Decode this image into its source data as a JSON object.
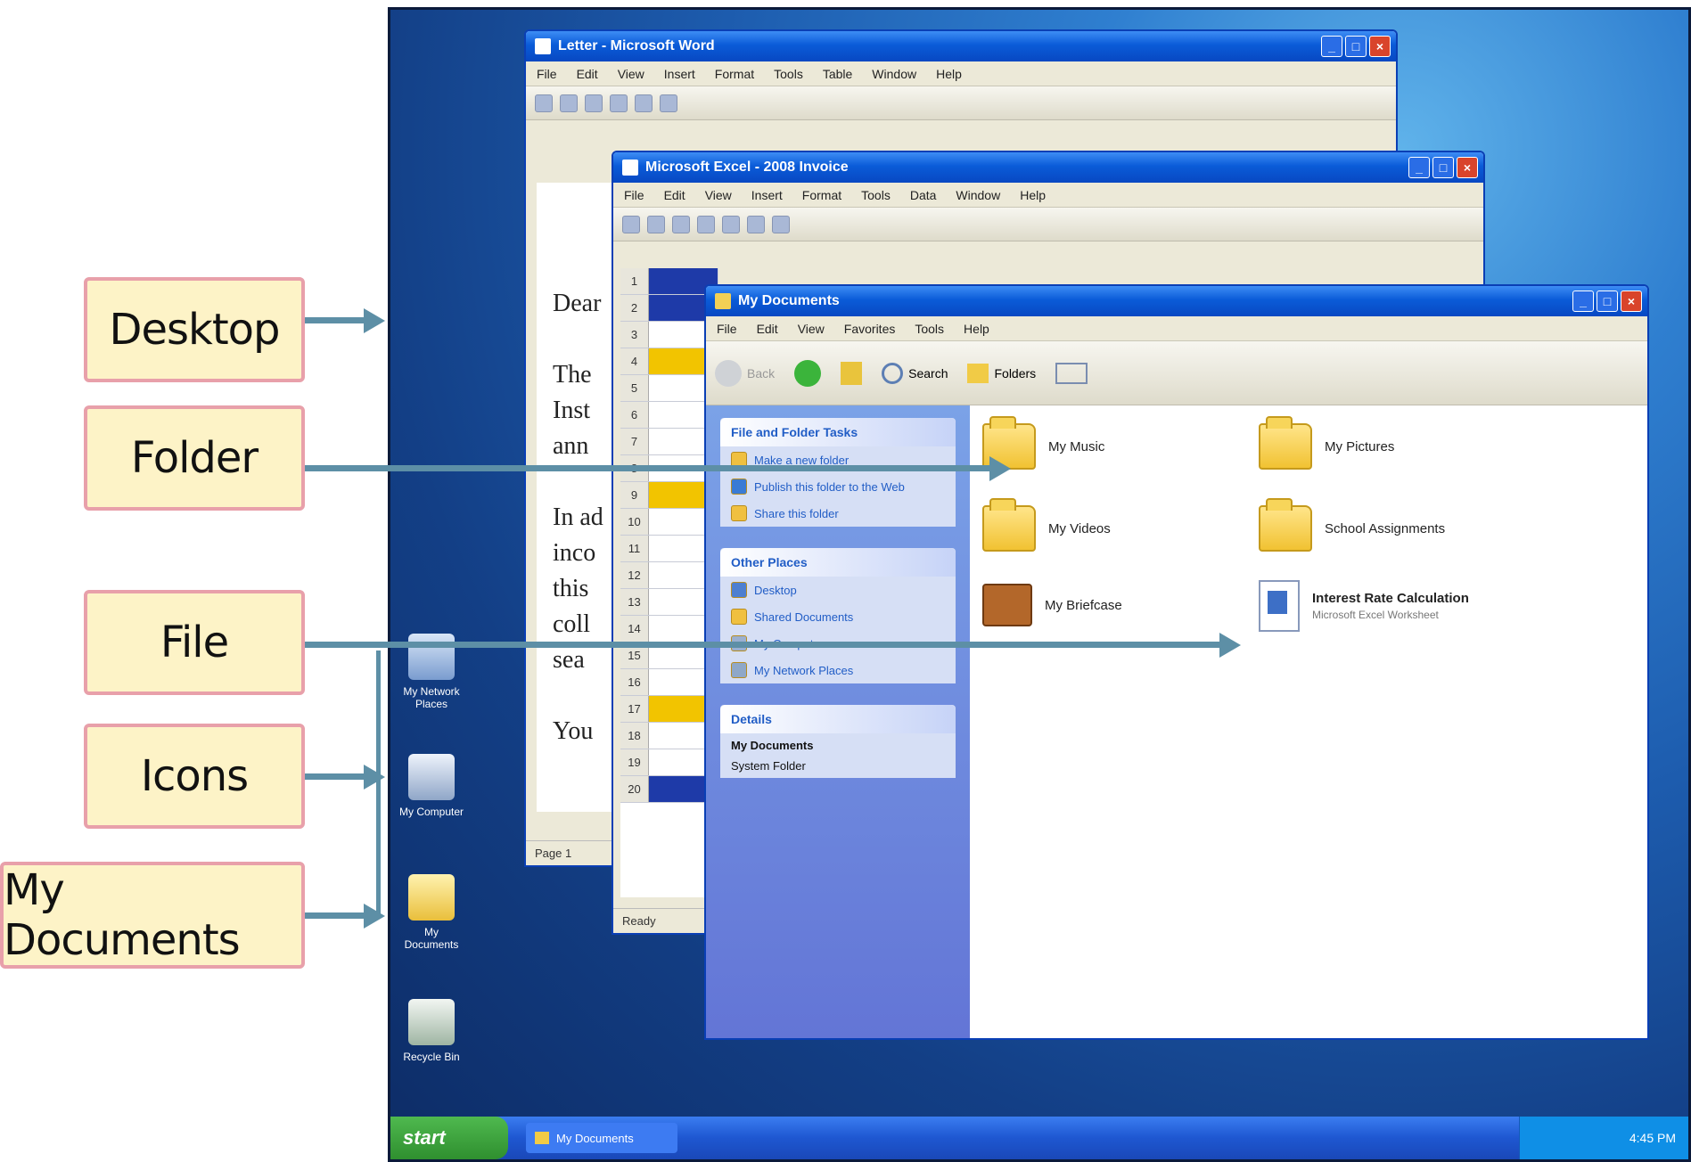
{
  "callouts": {
    "desktop": "Desktop",
    "folder": "Folder",
    "file": "File",
    "icons": "Icons",
    "my_documents": "My Documents"
  },
  "word": {
    "title": "Letter - Microsoft Word",
    "menus": [
      "File",
      "Edit",
      "View",
      "Insert",
      "Format",
      "Tools",
      "Table",
      "Window",
      "Help"
    ],
    "doc_lines": [
      "Dear",
      "The",
      "Inst",
      "ann",
      "In ad",
      "inco",
      "this",
      "coll",
      "sea",
      "You"
    ],
    "status": "Page 1"
  },
  "excel": {
    "title": "Microsoft Excel - 2008 Invoice",
    "menus": [
      "File",
      "Edit",
      "View",
      "Insert",
      "Format",
      "Tools",
      "Data",
      "Window",
      "Help"
    ],
    "rows": [
      "1",
      "2",
      "3",
      "4",
      "5",
      "6",
      "7",
      "8",
      "9",
      "10",
      "11",
      "12",
      "13",
      "14",
      "15",
      "16",
      "17",
      "18",
      "19",
      "20"
    ],
    "status": "Ready"
  },
  "explorer": {
    "title": "My Documents",
    "menus": [
      "File",
      "Edit",
      "View",
      "Favorites",
      "Tools",
      "Help"
    ],
    "toolbar": {
      "back": "Back",
      "search": "Search",
      "folders": "Folders"
    },
    "tasks_header": "File and Folder Tasks",
    "tasks": [
      "Make a new folder",
      "Publish this folder to the Web",
      "Share this folder"
    ],
    "places_header": "Other Places",
    "places": [
      "Desktop",
      "Shared Documents",
      "My Computer",
      "My Network Places"
    ],
    "details_header": "Details",
    "details_title": "My Documents",
    "details_sub": "System Folder",
    "items": [
      {
        "name": "My Music",
        "kind": "folder"
      },
      {
        "name": "My Pictures",
        "kind": "folder"
      },
      {
        "name": "My Videos",
        "kind": "folder"
      },
      {
        "name": "School Assignments",
        "kind": "folder"
      },
      {
        "name": "My Briefcase",
        "kind": "briefcase"
      },
      {
        "name": "Interest Rate Calculation",
        "kind": "file",
        "sub": "Microsoft Excel Worksheet"
      }
    ]
  },
  "desktop_icons": [
    "My Network Places",
    "My Computer",
    "My Documents",
    "Recycle Bin"
  ],
  "taskbar": {
    "start": "start",
    "task": "My Documents",
    "clock": "4:45 PM"
  }
}
